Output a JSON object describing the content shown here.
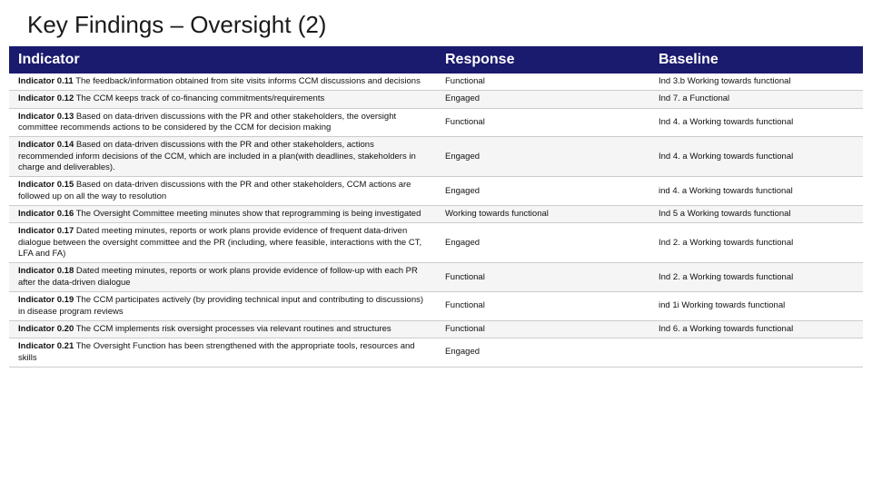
{
  "title": "Key Findings – Oversight (2)",
  "header": {
    "col1": "Indicator",
    "col2": "Response",
    "col3": "Baseline"
  },
  "rows": [
    {
      "indicator": "Indicator 0.11",
      "indicator_text": " The feedback/information obtained from site visits informs CCM discussions and decisions",
      "response": "Functional",
      "baseline": "Ind 3.b Working towards functional"
    },
    {
      "indicator": "Indicator 0.12",
      "indicator_text": " The CCM keeps track of co-financing commitments/requirements",
      "response": "Engaged",
      "baseline": "Ind 7. a Functional"
    },
    {
      "indicator": "Indicator 0.13",
      "indicator_text": " Based on data-driven discussions with the PR and other stakeholders, the oversight committee recommends actions to be considered by the CCM for decision making",
      "response": "Functional",
      "baseline": "Ind 4. a Working towards functional"
    },
    {
      "indicator": "Indicator 0.14",
      "indicator_text": " Based on data-driven discussions with the PR and other stakeholders, actions recommended inform decisions of the CCM, which are included in a plan(with deadlines, stakeholders in charge and deliverables).",
      "response": "Engaged",
      "baseline": "Ind 4. a Working towards functional"
    },
    {
      "indicator": "Indicator 0.15",
      "indicator_text": " Based on data-driven discussions with the PR and other stakeholders, CCM actions are followed up on all the way to resolution",
      "response": "Engaged",
      "baseline": "ind 4. a Working towards functional"
    },
    {
      "indicator": "Indicator 0.16",
      "indicator_text": " The Oversight Committee meeting minutes show that reprogramming is being investigated",
      "response": "Working towards functional",
      "baseline": "Ind 5 a Working towards functional"
    },
    {
      "indicator": "Indicator 0.17",
      "indicator_text": " Dated meeting minutes, reports or work plans provide evidence of frequent data-driven dialogue between the oversight committee and the PR (including, where feasible, interactions with the CT, LFA and FA)",
      "response": "Engaged",
      "baseline": "Ind 2. a Working towards functional"
    },
    {
      "indicator": "Indicator 0.18",
      "indicator_text": " Dated meeting minutes, reports or work plans provide evidence of follow-up with each PR after the data-driven dialogue",
      "response": "Functional",
      "baseline": "Ind 2. a Working towards functional"
    },
    {
      "indicator": "Indicator 0.19",
      "indicator_text": " The CCM participates actively (by providing technical input and contributing to discussions) in disease program reviews",
      "response": "Functional",
      "baseline": "ind 1i Working towards functional"
    },
    {
      "indicator": "Indicator 0.20",
      "indicator_text": " The CCM implements risk oversight processes via relevant routines and structures",
      "response": "Functional",
      "baseline": "Ind 6. a Working towards functional"
    },
    {
      "indicator": "Indicator 0.21",
      "indicator_text": " The Oversight Function has been strengthened with the appropriate tools, resources and skills",
      "response": "Engaged",
      "baseline": ""
    }
  ]
}
